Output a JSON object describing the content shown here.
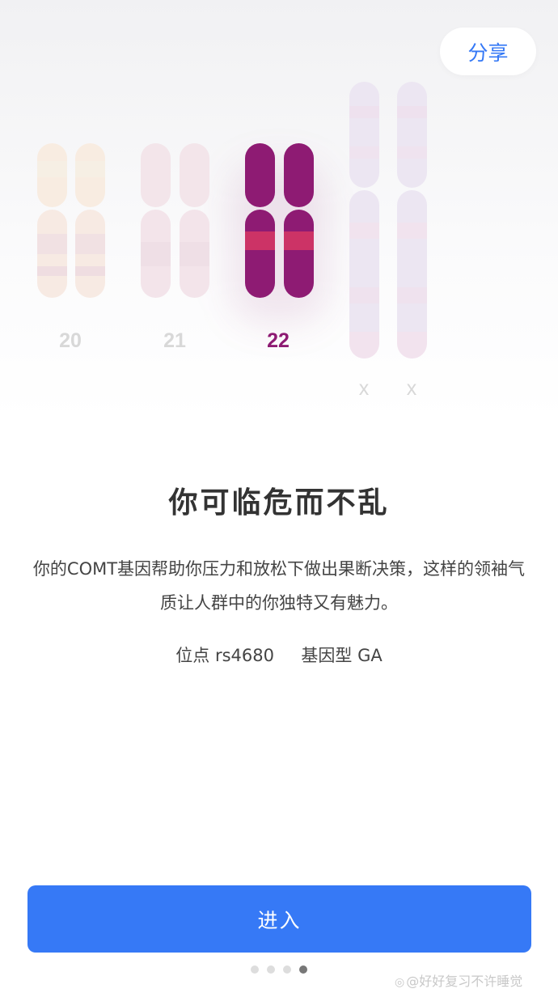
{
  "header": {
    "share_label": "分享"
  },
  "chromosomes": {
    "pairs": [
      {
        "number": "20",
        "selected": false,
        "color": "#f7ebe1",
        "label_color": "#d8d8d8"
      },
      {
        "number": "21",
        "selected": false,
        "color": "#f3e4ea",
        "label_color": "#d8d8d8"
      },
      {
        "number": "22",
        "selected": true,
        "color": "#8e1b73",
        "band_color": "#cc3366",
        "label_color": "#8e1b73"
      },
      {
        "number": "x",
        "selected": false,
        "color": "#ebe3f1",
        "label_color": "#d8d8d8"
      },
      {
        "number": "x",
        "selected": false,
        "color": "#ebe3f1",
        "label_color": "#d8d8d8"
      }
    ]
  },
  "content": {
    "title": "你可临危而不乱",
    "description": "你的COMT基因帮助你压力和放松下做出果断决策，这样的领袖气质让人群中的你独特又有魅力。",
    "locus_label": "位点",
    "locus_value": "rs4680",
    "genotype_label": "基因型",
    "genotype_value": "GA"
  },
  "footer": {
    "enter_label": "进入",
    "page_count": 4,
    "active_page": 4
  },
  "watermark": {
    "icon": "weibo-icon",
    "text": "@好好复习不许睡觉"
  },
  "colors": {
    "accent": "#3679f6",
    "highlight": "#8e1b73"
  }
}
